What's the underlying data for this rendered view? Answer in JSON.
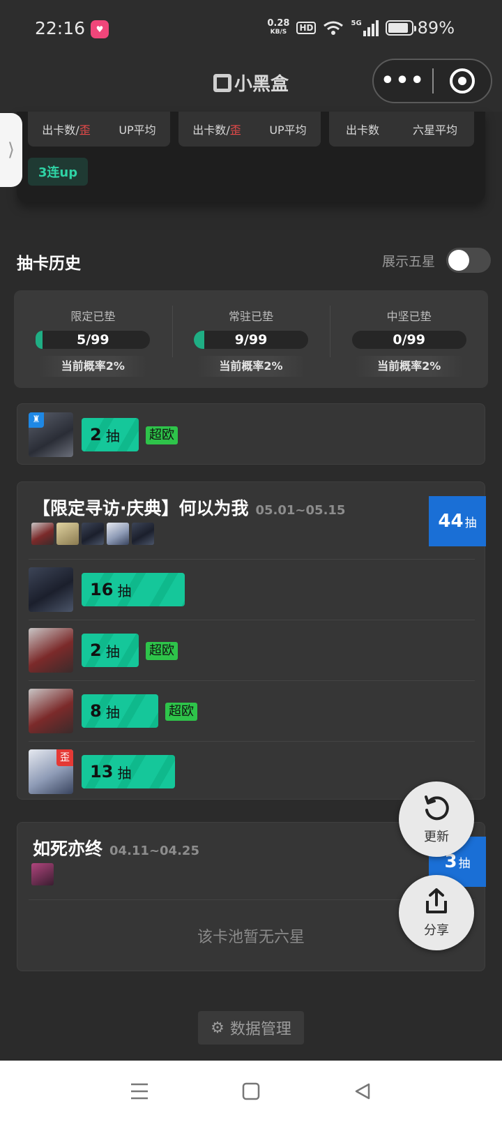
{
  "status_bar": {
    "time": "22:16",
    "app_icon": "heart-icon",
    "net_speed_value": "0.28",
    "net_speed_unit": "KB/S",
    "hd": "HD",
    "signal_label": "5G",
    "battery_percent": "89%",
    "battery_level": 0.89
  },
  "nav": {
    "title": "小黑盒",
    "more": "•••"
  },
  "top_stats": {
    "boxes": [
      {
        "left": "出卡数",
        "sep": "/",
        "red": "歪",
        "right": "UP平均"
      },
      {
        "left": "出卡数",
        "sep": "/",
        "red": "歪",
        "right": "UP平均"
      },
      {
        "left": "出卡数",
        "sep": "",
        "red": "",
        "right": "六星平均"
      }
    ],
    "tag": "3连up"
  },
  "history": {
    "title": "抽卡历史",
    "show_five_star_label": "展示五星",
    "show_five_star_on": false
  },
  "pity": [
    {
      "label": "限定已垫",
      "value": "5/99",
      "progress": 0.05,
      "rate": "当前概率2%"
    },
    {
      "label": "常驻已垫",
      "value": "9/99",
      "progress": 0.09,
      "rate": "当前概率2%"
    },
    {
      "label": "中坚已垫",
      "value": "0/99",
      "progress": 0.0,
      "rate": "当前概率2%"
    }
  ],
  "single_card": {
    "pulls": {
      "num": "2",
      "unit": "抽",
      "tag": "超欧",
      "badge": "♜"
    }
  },
  "pool1": {
    "title": "【限定寻访·庆典】何以为我",
    "date": "05.01~05.15",
    "total_num": "44",
    "total_unit": "抽",
    "rows": [
      {
        "num": "16",
        "unit": "抽",
        "tag": "",
        "badge": ""
      },
      {
        "num": "2",
        "unit": "抽",
        "tag": "超欧",
        "badge": ""
      },
      {
        "num": "8",
        "unit": "抽",
        "tag": "超欧",
        "badge": ""
      },
      {
        "num": "13",
        "unit": "抽",
        "tag": "",
        "badge": "歪"
      }
    ]
  },
  "pool2": {
    "title": "如死亦终",
    "date": "04.11~04.25",
    "total_num": "3",
    "total_unit": "抽",
    "empty": "该卡池暂无六星"
  },
  "fabs": {
    "refresh": "更新",
    "share": "分享"
  },
  "footer": {
    "data_management": "数据管理"
  },
  "bottom_nav": {
    "icons": [
      "menu-icon",
      "home-icon",
      "back-icon"
    ]
  }
}
